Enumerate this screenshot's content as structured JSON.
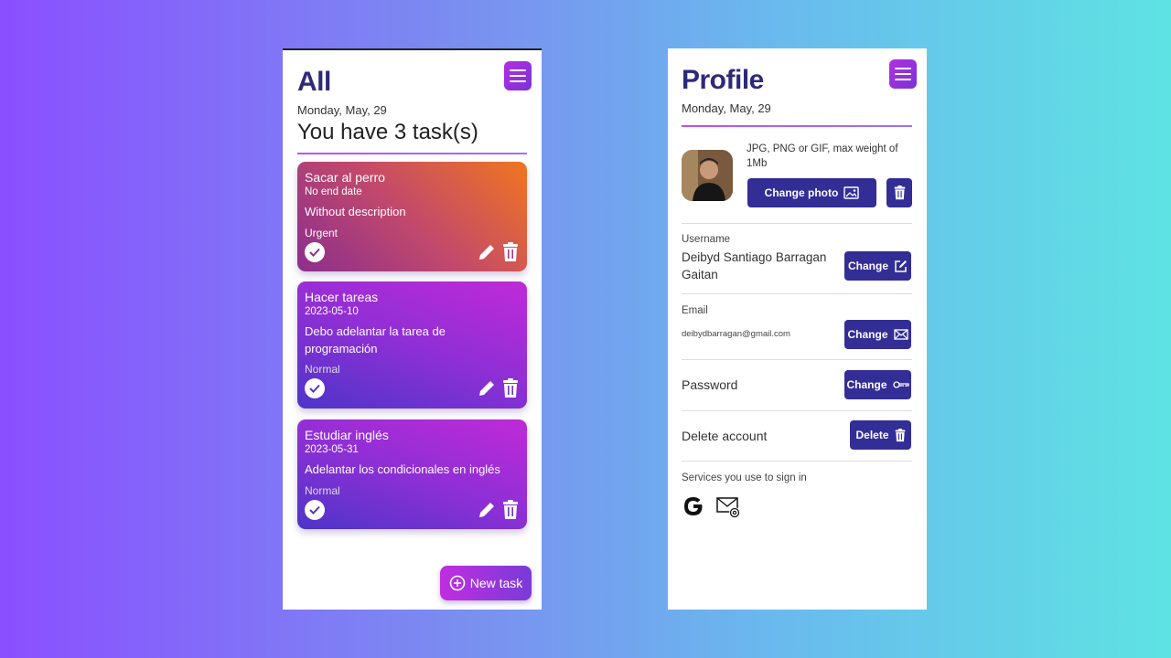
{
  "tasks_screen": {
    "title": "All",
    "date": "Monday, May, 29",
    "summary": "You have 3 task(s)",
    "tasks": [
      {
        "title": "Sacar al perro",
        "date": "No end date",
        "description": "Without description",
        "priority": "Urgent"
      },
      {
        "title": "Hacer tareas",
        "date": "2023-05-10",
        "description": "Debo adelantar la tarea de programación",
        "priority": "Normal"
      },
      {
        "title": "Estudiar inglés",
        "date": "2023-05-31",
        "description": "Adelantar los condicionales en inglés",
        "priority": "Normal"
      }
    ],
    "new_task_label": "New task"
  },
  "profile_screen": {
    "title": "Profile",
    "date": "Monday, May, 29",
    "photo_hint": "JPG, PNG or GIF, max weight of 1Mb",
    "change_photo_label": "Change photo",
    "username_label": "Username",
    "username_value": "Deibyd Santiago Barragan Gaitan",
    "change_label": "Change",
    "email_label": "Email",
    "email_value": "deibydbarragan@gmail.com",
    "password_label": "Password",
    "delete_account_label": "Delete account",
    "delete_label": "Delete",
    "services_label": "Services you use to sign in"
  },
  "colors": {
    "accent": "#332d96",
    "heading": "#2e2a7a",
    "urgent_gradient": [
      "#f07520",
      "#a6338f"
    ],
    "normal_gradient": [
      "#b62ad8",
      "#4d35c9"
    ]
  },
  "icons": [
    "menu-icon",
    "check-icon",
    "pencil-icon",
    "trash-icon",
    "plus-circle-icon",
    "image-icon",
    "edit-square-icon",
    "envelope-icon",
    "key-icon",
    "google-icon",
    "email-at-icon"
  ]
}
